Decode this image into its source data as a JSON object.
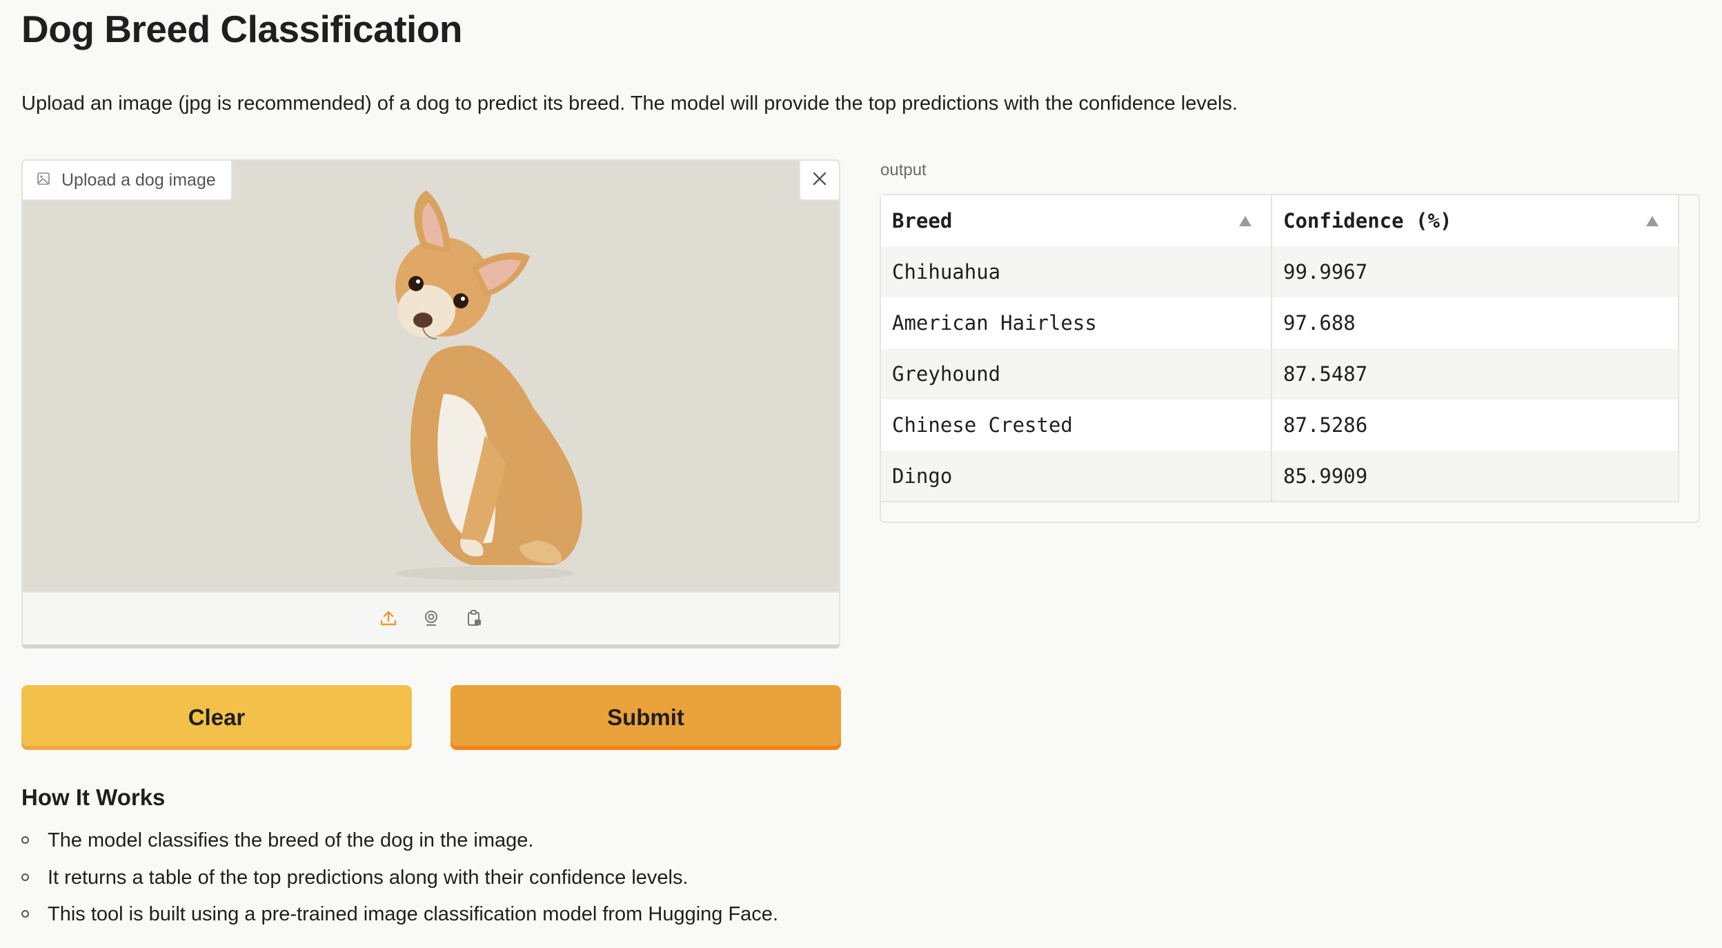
{
  "header": {
    "title": "Dog Breed Classification",
    "description": "Upload an image (jpg is recommended) of a dog to predict its breed. The model will provide the top predictions with the confidence levels."
  },
  "upload": {
    "label": "Upload a dog image",
    "label_icon": "image-icon",
    "close_icon": "close-icon",
    "source_icons": [
      "upload-icon",
      "webcam-icon",
      "clipboard-icon"
    ],
    "accent_color": "#eb9a2c"
  },
  "buttons": {
    "clear_label": "Clear",
    "submit_label": "Submit",
    "clear_color": "#f3c149",
    "submit_color": "#eaa23b"
  },
  "output": {
    "label": "output",
    "columns": [
      "Breed",
      "Confidence (%)"
    ],
    "rows": [
      [
        "Chihuahua",
        "99.9967"
      ],
      [
        "American Hairless",
        "97.688"
      ],
      [
        "Greyhound",
        "87.5487"
      ],
      [
        "Chinese Crested",
        "87.5286"
      ],
      [
        "Dingo",
        "85.9909"
      ]
    ]
  },
  "how_it_works": {
    "title": "How It Works",
    "items": [
      "The model classifies the breed of the dog in the image.",
      "It returns a table of the top predictions along with their confidence levels.",
      "This tool is built using a pre-trained image classification model from Hugging Face."
    ]
  }
}
